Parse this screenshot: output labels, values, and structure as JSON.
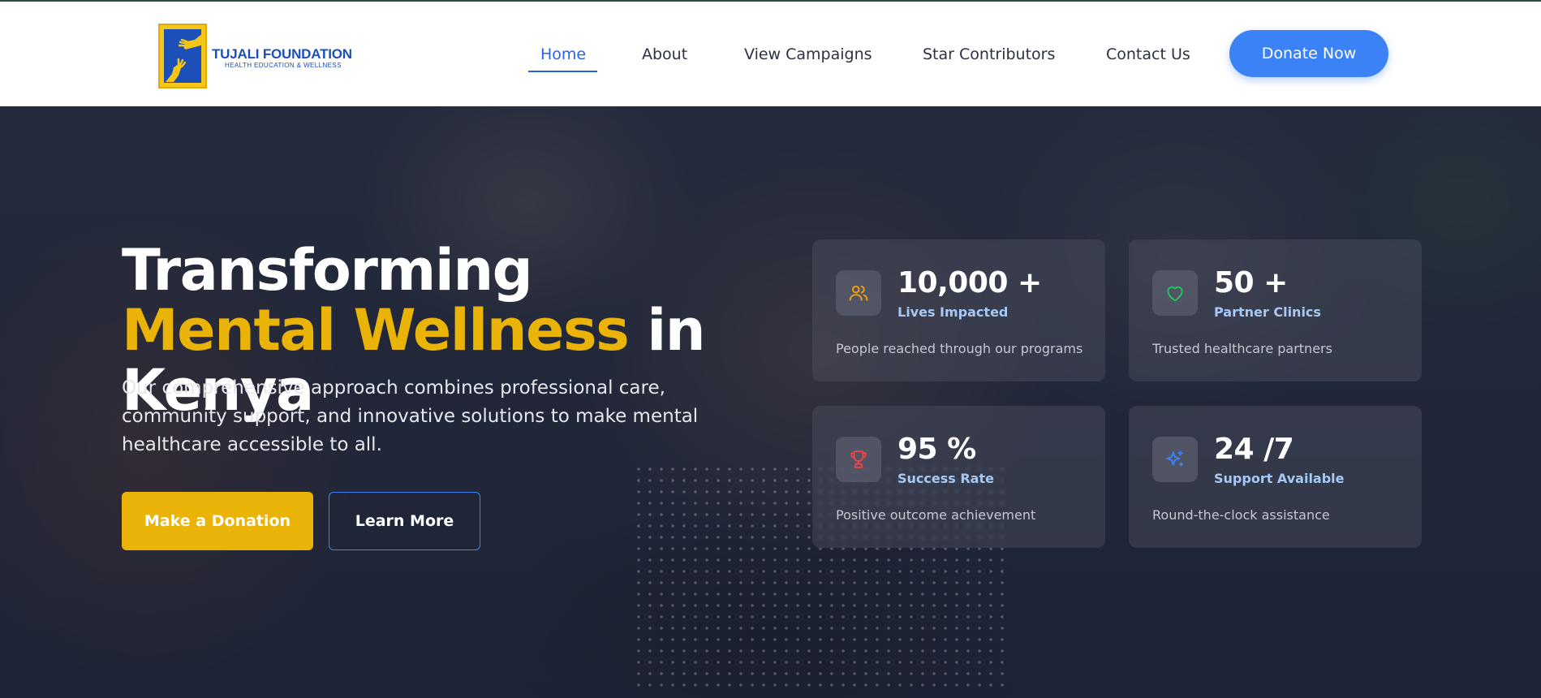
{
  "brand": {
    "name": "TUJALI FOUNDATION",
    "tagline": "HEALTH EDUCATION & WELLNESS",
    "logo_colors": {
      "background": "#f5c518",
      "panel": "#1d4fb8"
    }
  },
  "nav": {
    "items": [
      {
        "label": "Home",
        "active": true
      },
      {
        "label": "About",
        "active": false
      },
      {
        "label": "View Campaigns",
        "active": false
      },
      {
        "label": "Star Contributors",
        "active": false
      },
      {
        "label": "Contact Us",
        "active": false
      }
    ],
    "cta_label": "Donate Now"
  },
  "hero": {
    "headline_part1": "Transforming ",
    "headline_accent": "Mental Wellness",
    "headline_part2": " in Kenya",
    "description": "Our comprehensive approach combines professional care, community support, and innovative solutions to make mental healthcare accessible to all.",
    "primary_button": "Make a Donation",
    "secondary_button": "Learn More"
  },
  "stats": [
    {
      "value": "10,000 +",
      "label": "Lives Impacted",
      "description": "People reached through our programs",
      "icon": "users-icon",
      "icon_color": "#f59e0b"
    },
    {
      "value": "50 +",
      "label": "Partner Clinics",
      "description": "Trusted healthcare partners",
      "icon": "heart-icon",
      "icon_color": "#22c55e"
    },
    {
      "value": "95 %",
      "label": "Success Rate",
      "description": "Positive outcome achievement",
      "icon": "trophy-icon",
      "icon_color": "#ef4444"
    },
    {
      "value": "24 /7",
      "label": "Support Available",
      "description": "Round-the-clock assistance",
      "icon": "sparkles-icon",
      "icon_color": "#3b82f6"
    }
  ],
  "colors": {
    "accent_yellow": "#eab308",
    "primary_blue": "#3b82f6",
    "nav_active": "#2563eb"
  }
}
